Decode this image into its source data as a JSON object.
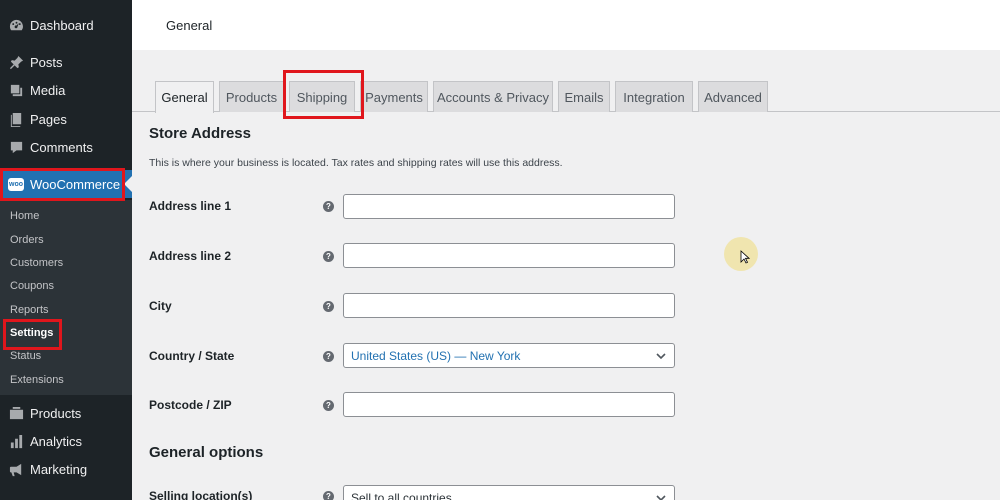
{
  "sidebar": {
    "menu": [
      {
        "label": "Dashboard",
        "icon": "dashboard-icon"
      },
      {
        "label": "Posts",
        "icon": "pin-icon"
      },
      {
        "label": "Media",
        "icon": "media-icon"
      },
      {
        "label": "Pages",
        "icon": "pages-icon"
      },
      {
        "label": "Comments",
        "icon": "comment-icon"
      },
      {
        "label": "WooCommerce",
        "icon": "woocommerce-icon",
        "badge": "woo"
      }
    ],
    "submenu": [
      "Home",
      "Orders",
      "Customers",
      "Coupons",
      "Reports",
      "Settings",
      "Status",
      "Extensions"
    ],
    "lower_menu": [
      {
        "label": "Products",
        "icon": "products-icon"
      },
      {
        "label": "Analytics",
        "icon": "analytics-icon"
      },
      {
        "label": "Marketing",
        "icon": "megaphone-icon"
      }
    ]
  },
  "header": {
    "title": "General"
  },
  "tabs": [
    "General",
    "Products",
    "Shipping",
    "Payments",
    "Accounts & Privacy",
    "Emails",
    "Integration",
    "Advanced"
  ],
  "store_address": {
    "title": "Store Address",
    "description": "This is where your business is located. Tax rates and shipping rates will use this address.",
    "fields": {
      "address1": {
        "label": "Address line 1",
        "value": ""
      },
      "address2": {
        "label": "Address line 2",
        "value": ""
      },
      "city": {
        "label": "City",
        "value": ""
      },
      "country": {
        "label": "Country / State",
        "value": "United States (US) — New York"
      },
      "postcode": {
        "label": "Postcode / ZIP",
        "value": ""
      }
    }
  },
  "general_options": {
    "title": "General options",
    "selling_location": {
      "label": "Selling location(s)",
      "value": "Sell to all countries"
    }
  },
  "help_glyph": "?",
  "colors": {
    "accent": "#2271b1",
    "highlight": "#e0161c",
    "sidebar": "#1d2327"
  }
}
